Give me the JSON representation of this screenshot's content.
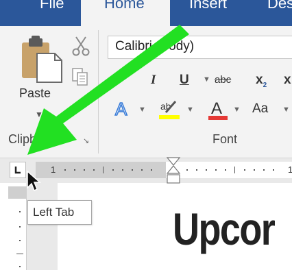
{
  "tabs": {
    "file": "File",
    "home": "Home",
    "insert": "Insert",
    "design": "Des"
  },
  "clipboard": {
    "paste_label": "Paste",
    "group_label": "Clipboard"
  },
  "font": {
    "current_font": "Calibri (Body)",
    "group_label": "Font",
    "change_case_label": "Aa",
    "highlight_color": "#ffff00",
    "font_color": "#e53935"
  },
  "ruler": {
    "tick_1": "1",
    "tick_2": "1"
  },
  "tooltip": {
    "text": "Left Tab"
  },
  "document": {
    "heading": "Upcor"
  },
  "colors": {
    "accent": "#2b579a",
    "annotation_arrow": "#22e022"
  }
}
